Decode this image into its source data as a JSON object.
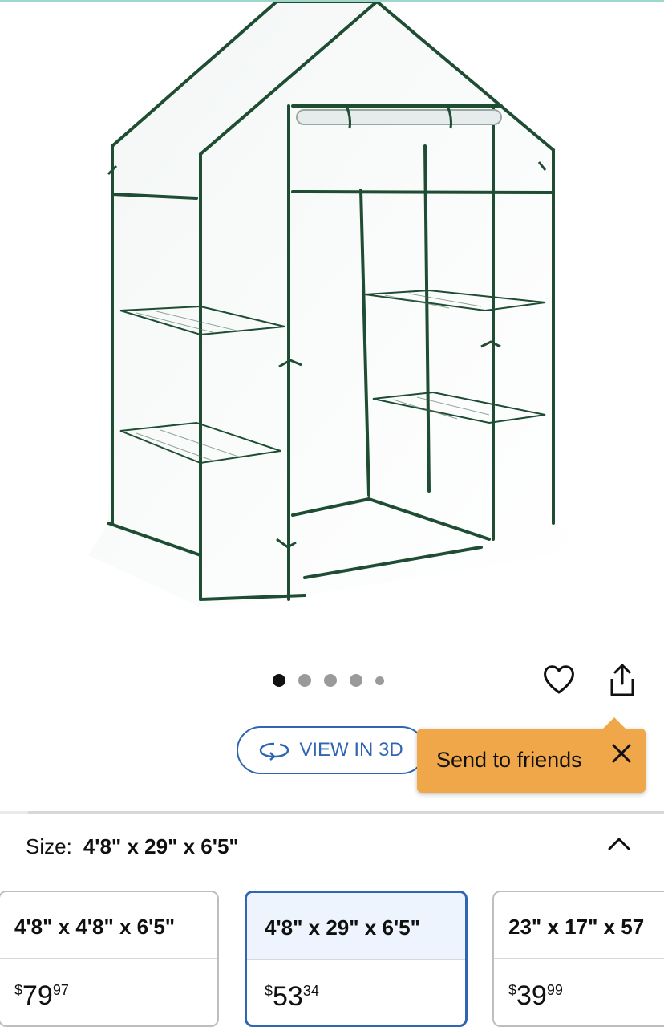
{
  "product_image": {
    "alt": "",
    "dots_total": 5,
    "active_dot": 0
  },
  "actions": {
    "favorite_icon": "heart-icon",
    "share_icon": "share-icon"
  },
  "view3d": {
    "label": "VIEW IN 3D",
    "icon": "rotate-3d-icon"
  },
  "tooltip": {
    "text": "Send to friends",
    "close_icon": "close-icon"
  },
  "size": {
    "label": "Size:",
    "selected": "4'8\" x 29\" x 6'5\"",
    "toggle_icon": "chevron-up-icon"
  },
  "options": [
    {
      "title": "4'8\" x 4'8\" x 6'5\"",
      "price_symbol": "$",
      "price_whole": "79",
      "price_cents": "97",
      "selected": false
    },
    {
      "title": "4'8\" x 29\" x 6'5\"",
      "price_symbol": "$",
      "price_whole": "53",
      "price_cents": "34",
      "selected": true
    },
    {
      "title": "23\" x 17\" x 57",
      "price_symbol": "$",
      "price_whole": "39",
      "price_cents": "99",
      "selected": false
    }
  ],
  "colors": {
    "accent": "#2f66b3",
    "tooltip_bg": "#f0a74a",
    "frame_green": "#1e4d33"
  }
}
